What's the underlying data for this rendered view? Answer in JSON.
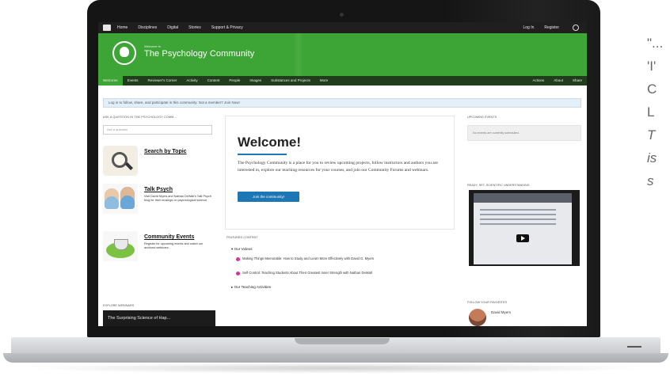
{
  "topnav": {
    "items": [
      "Home",
      "Disciplines",
      "Digital",
      "Stories",
      "Support & Privacy"
    ],
    "right": [
      "Log In",
      "Register"
    ]
  },
  "banner": {
    "welcome_to": "Welcome to",
    "site_name": "The Psychology Community"
  },
  "secnav": {
    "items": [
      "Welcome",
      "Events",
      "Reviewer's Corner",
      "Activity",
      "Content",
      "People",
      "Images",
      "Substances and Projects",
      "More"
    ],
    "right": [
      "Actions",
      "About",
      "Share"
    ]
  },
  "alert": "Log in to follow, share, and participate in this community. Not a member? Join Now!",
  "left": {
    "ask_header": "ASK A QUESTION IN THE PSYCHOLOGY COMM...",
    "ask_placeholder": "Ask a question",
    "features": [
      {
        "title": "Search by Topic",
        "desc": ""
      },
      {
        "title": "Talk Psych",
        "desc": "Visit David Myers and Nathan DeWall's Talk Psych blog for their musings on psychological science."
      },
      {
        "title": "Community Events",
        "desc": "Register for upcoming events and watch our archived webinars."
      }
    ],
    "explore_header": "EXPLORE WEBINARS",
    "video_bar": "The Surprising Science of Hap..."
  },
  "main": {
    "welcome_title": "Welcome!",
    "welcome_text": "The Psychology Community is a place for you to review upcoming projects, follow instructors and authors you are interested in, explore our teaching resources for your courses, and join our Community Forums and webinars.",
    "join_button": "Join the community!",
    "featured_header": "FEATURED CONTENT",
    "sections": [
      "Our Videos",
      "Our Teaching Activities"
    ],
    "videos": [
      "Making Things Memorable: How to Study and Learn More Effectively with David G. Myers",
      "Self Control: Teaching Students About Their Greatest Inner Strength with Nathan DeWall"
    ]
  },
  "right": {
    "upcoming_header": "UPCOMING EVENTS",
    "no_content": "No events are currently scheduled.",
    "video_header": "READY, SET, SCIENTIFIC UNDERSTANDING",
    "follow_header": "FOLLOW YOUR FAVORITES",
    "person": "David Myers"
  },
  "side_text": [
    "\"...",
    "'I'",
    "C",
    "L",
    "T",
    "is",
    "s"
  ]
}
